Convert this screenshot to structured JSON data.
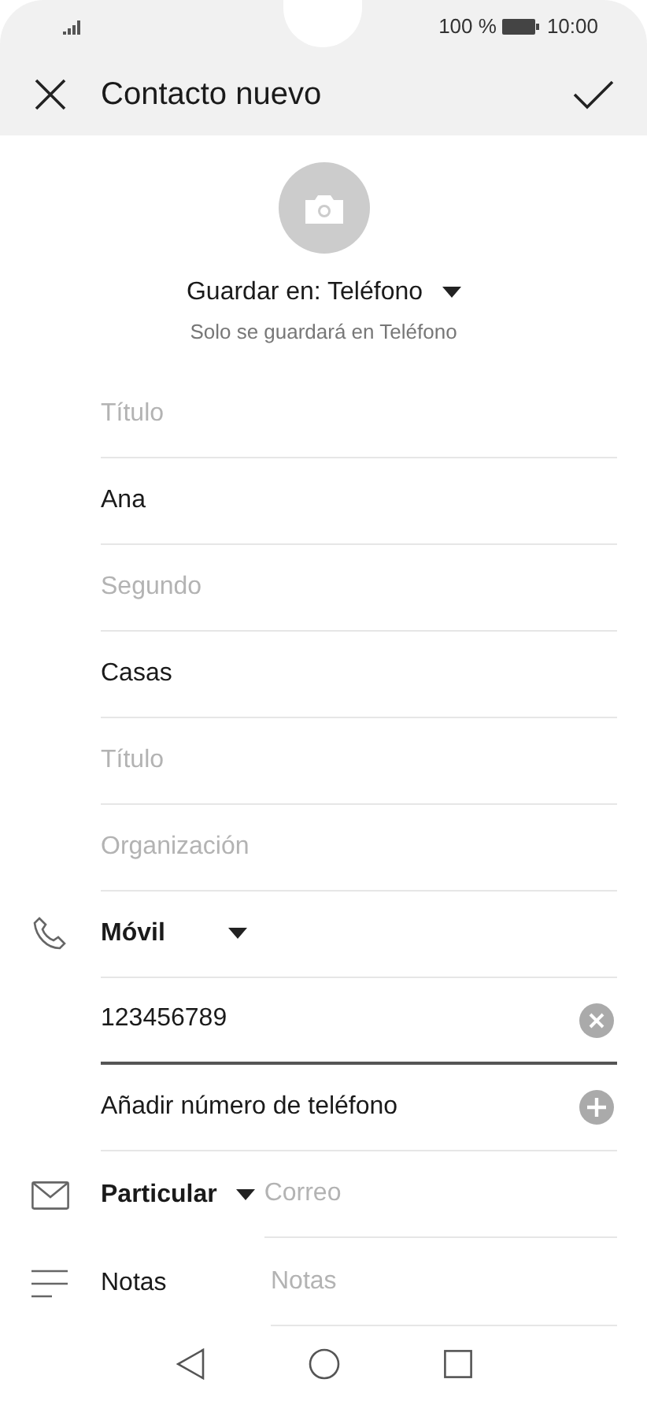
{
  "status_bar": {
    "battery": "100 %",
    "time": "10:00"
  },
  "header": {
    "title": "Contacto nuevo"
  },
  "storage": {
    "label": "Guardar en: Teléfono",
    "note": "Solo se guardará en Teléfono"
  },
  "name_fields": [
    {
      "placeholder": "Título"
    },
    {
      "value": "Ana"
    },
    {
      "placeholder": "Segundo"
    },
    {
      "value": "Casas"
    },
    {
      "placeholder": "Título"
    },
    {
      "placeholder": "Organización"
    }
  ],
  "phone": {
    "type": "Móvil",
    "value": "123456789",
    "focused": true,
    "add_label": "Añadir número de teléfono"
  },
  "email": {
    "type": "Particular",
    "placeholder": "Correo"
  },
  "notes": {
    "label": "Notas",
    "placeholder": "Notas"
  }
}
